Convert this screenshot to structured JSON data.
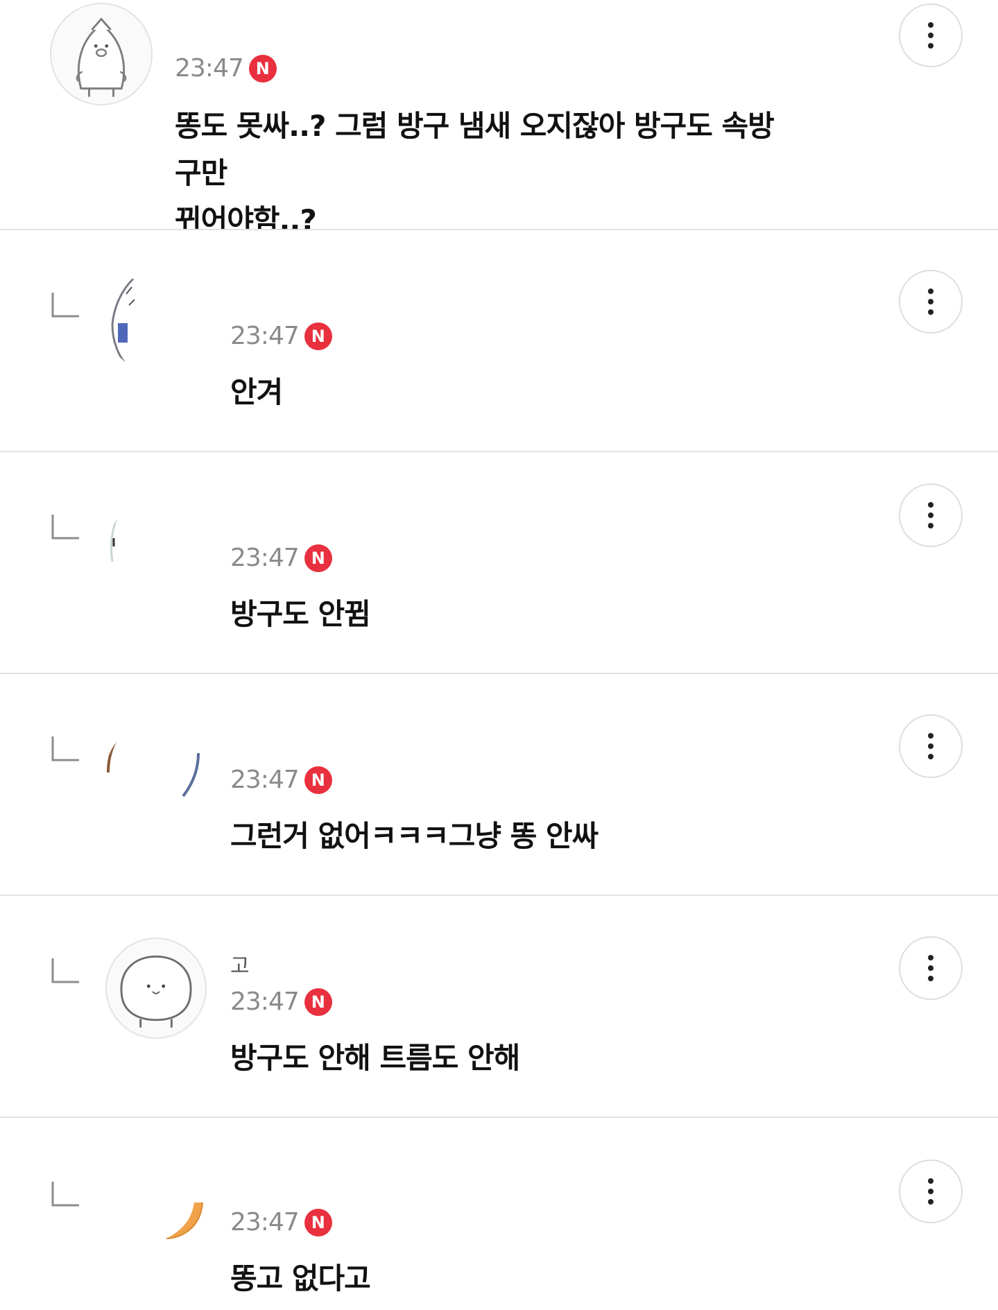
{
  "comments": [
    {
      "username": "",
      "time": "23:47",
      "badge": "N",
      "text": "똥도 못싸..? 그럼 방구 냄새 오지잖아 방구도 속방구만\n뀌어야함..?",
      "avatar": "penguin-avatar-icon",
      "is_reply": false
    },
    {
      "username": "",
      "time": "23:47",
      "badge": "N",
      "text": "안겨",
      "avatar": "photo-avatar",
      "is_reply": true
    },
    {
      "username": "",
      "time": "23:47",
      "badge": "N",
      "text": "방구도 안뀜",
      "avatar": "photo-avatar",
      "is_reply": true
    },
    {
      "username": "",
      "time": "23:47",
      "badge": "N",
      "text": "그런거 없어ㅋㅋㅋ그냥 똥 안싸",
      "avatar": "photo-avatar",
      "is_reply": true
    },
    {
      "username": "고",
      "time": "23:47",
      "badge": "N",
      "text": "방구도 안해 트름도 안해",
      "avatar": "blob-avatar-icon",
      "is_reply": true
    },
    {
      "username": "",
      "time": "23:47",
      "badge": "N",
      "text": "똥고 없다고",
      "avatar": "photo-avatar",
      "is_reply": true
    }
  ],
  "colors": {
    "badge": "#e8303e",
    "time": "#8a8a8a",
    "divider": "#e2e2e2",
    "text": "#111111"
  },
  "icons": {
    "more": "more-vertical-icon",
    "reply": "reply-corner-icon"
  }
}
